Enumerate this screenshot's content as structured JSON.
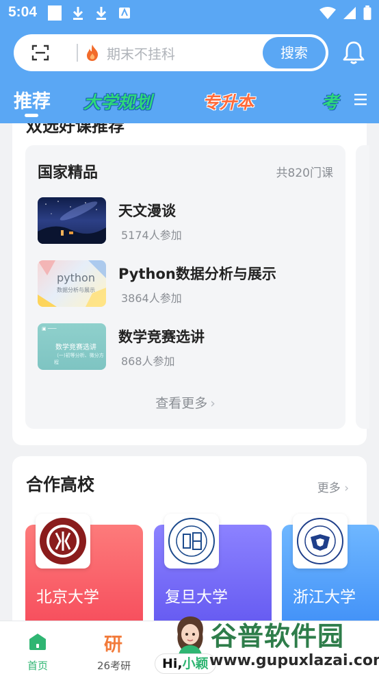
{
  "status_bar": {
    "time": "5:04"
  },
  "search": {
    "placeholder": "期末不挂科",
    "button": "搜索"
  },
  "tabs": [
    {
      "label": "推荐"
    },
    {
      "label": "大学规划"
    },
    {
      "label": "专升本"
    },
    {
      "label": "考"
    }
  ],
  "partial_section_title": "双选好课推荐",
  "national": {
    "title": "国家精品",
    "count": "共820门课",
    "courses": [
      {
        "title": "天文漫谈",
        "participants": "5174人参加"
      },
      {
        "title": "Python数据分析与展示",
        "participants": "3864人参加",
        "thumb_text": "python",
        "thumb_sub": "数据分析与展示"
      },
      {
        "title": "数学竞赛选讲",
        "participants": "868人参加",
        "thumb_text": "数学竞赛选讲",
        "thumb_sub": "（一)初等分析、微分方程"
      }
    ],
    "see_more": "查看更多"
  },
  "partners": {
    "title": "合作高校",
    "more": "更多",
    "universities": [
      {
        "name": "北京大学",
        "color": "#f64a5a"
      },
      {
        "name": "复旦大学",
        "color": "#6257f0"
      },
      {
        "name": "浙江大学",
        "color": "#3e8ef7"
      }
    ]
  },
  "bottom_nav": {
    "home_label": "首页",
    "exam_icon_text": "研",
    "exam_label": "26考研",
    "assistant_hi": "Hi,",
    "assistant_name": "小颖"
  },
  "watermark": {
    "brand": "谷普软件园",
    "url": "www.gupuxlazai.com"
  },
  "colors": {
    "header_blue": "#5aa7f4",
    "accent_green": "#2fb572",
    "exam_orange": "#f27b3b"
  }
}
